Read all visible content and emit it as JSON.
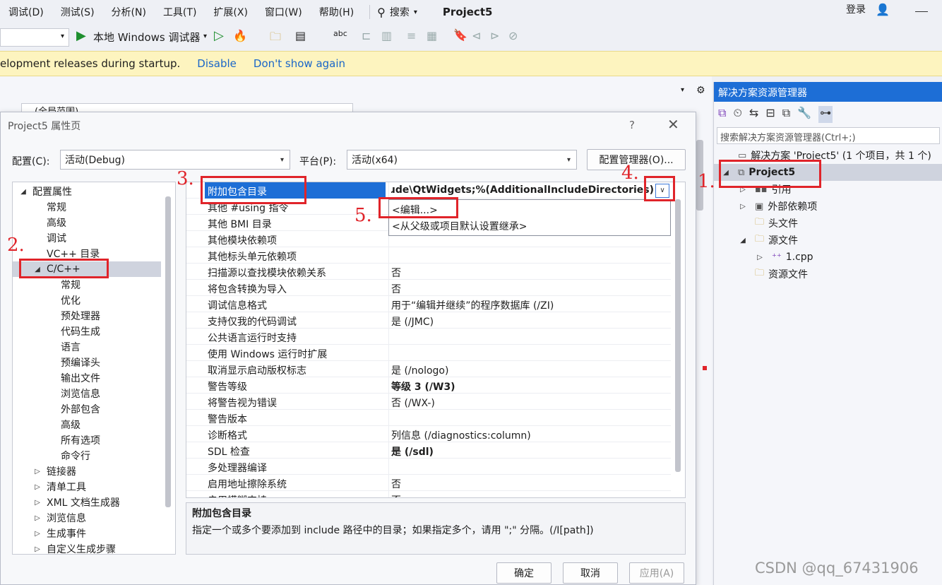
{
  "menu": [
    "调试(D)",
    "测试(S)",
    "分析(N)",
    "工具(T)",
    "扩展(X)",
    "窗口(W)",
    "帮助(H)"
  ],
  "search_label": "搜索",
  "project_title": "Project5",
  "login": "登录",
  "toolbar": {
    "debugger": "本地 Windows 调试器"
  },
  "infobar": {
    "message": "elopment releases during startup.",
    "disable": "Disable",
    "dont_show": "Don't show again"
  },
  "editor": {
    "scope": "(全局范围)"
  },
  "dialog": {
    "title": "Project5 属性页",
    "help": "?",
    "config_label": "配置(C):",
    "config_value": "活动(Debug)",
    "platform_label": "平台(P):",
    "platform_value": "活动(x64)",
    "config_manager": "配置管理器(O)...",
    "ok": "确定",
    "cancel": "取消",
    "apply": "应用(A)"
  },
  "tree": [
    {
      "label": "配置属性",
      "level": 0,
      "exp": "open"
    },
    {
      "label": "常规",
      "level": 1
    },
    {
      "label": "高级",
      "level": 1
    },
    {
      "label": "调试",
      "level": 1
    },
    {
      "label": "VC++ 目录",
      "level": 1
    },
    {
      "label": "C/C++",
      "level": 1,
      "exp": "open",
      "selected": true
    },
    {
      "label": "常规",
      "level": 2
    },
    {
      "label": "优化",
      "level": 2
    },
    {
      "label": "预处理器",
      "level": 2
    },
    {
      "label": "代码生成",
      "level": 2
    },
    {
      "label": "语言",
      "level": 2
    },
    {
      "label": "预编译头",
      "level": 2
    },
    {
      "label": "输出文件",
      "level": 2
    },
    {
      "label": "浏览信息",
      "level": 2
    },
    {
      "label": "外部包含",
      "level": 2
    },
    {
      "label": "高级",
      "level": 2
    },
    {
      "label": "所有选项",
      "level": 2
    },
    {
      "label": "命令行",
      "level": 2
    },
    {
      "label": "链接器",
      "level": 1,
      "exp": "closed"
    },
    {
      "label": "清单工具",
      "level": 1,
      "exp": "closed"
    },
    {
      "label": "XML 文档生成器",
      "level": 1,
      "exp": "closed"
    },
    {
      "label": "浏览信息",
      "level": 1,
      "exp": "closed"
    },
    {
      "label": "生成事件",
      "level": 1,
      "exp": "closed"
    },
    {
      "label": "自定义生成步骤",
      "level": 1,
      "exp": "closed"
    }
  ],
  "props": [
    {
      "name": "附加包含目录",
      "value": "nclude\\QtWidgets;%(AdditionalIncludeDirectories)",
      "selected": true,
      "bold": true
    },
    {
      "name": "其他 #using 指令",
      "value": ""
    },
    {
      "name": "其他 BMI 目录",
      "value": ""
    },
    {
      "name": "其他模块依赖项",
      "value": ""
    },
    {
      "name": "其他标头单元依赖项",
      "value": ""
    },
    {
      "name": "扫描源以查找模块依赖关系",
      "value": "否"
    },
    {
      "name": "将包含转换为导入",
      "value": "否"
    },
    {
      "name": "调试信息格式",
      "value": "用于“编辑并继续”的程序数据库 (/ZI)"
    },
    {
      "name": "支持仅我的代码调试",
      "value": "是 (/JMC)"
    },
    {
      "name": "公共语言运行时支持",
      "value": ""
    },
    {
      "name": "使用 Windows 运行时扩展",
      "value": ""
    },
    {
      "name": "取消显示启动版权标志",
      "value": "是 (/nologo)"
    },
    {
      "name": "警告等级",
      "value": "等级 3 (/W3)",
      "bold": true
    },
    {
      "name": "将警告视为错误",
      "value": "否 (/WX-)"
    },
    {
      "name": "警告版本",
      "value": ""
    },
    {
      "name": "诊断格式",
      "value": "列信息 (/diagnostics:column)"
    },
    {
      "name": "SDL 检查",
      "value": "是 (/sdl)",
      "bold": true
    },
    {
      "name": "多处理器编译",
      "value": ""
    },
    {
      "name": "启用地址擦除系统",
      "value": "否"
    },
    {
      "name": "启用模糊支持",
      "value": "否"
    }
  ],
  "dropdown": {
    "edit": "<编辑...>",
    "inherit": "<从父级或项目默认设置继承>"
  },
  "description": {
    "title": "附加包含目录",
    "text": "指定一个或多个要添加到 include 路径中的目录；如果指定多个，请用 \";\" 分隔。(/I[path])"
  },
  "solution": {
    "title": "解决方案资源管理器",
    "search_placeholder": "搜索解决方案资源管理器(Ctrl+;)",
    "items": [
      {
        "label": "解决方案 'Project5' (1 个项目，共 1 个)",
        "level": 0,
        "icon": "solution-icon"
      },
      {
        "label": "Project5",
        "level": 0,
        "exp": "open",
        "bold": true,
        "selected": true,
        "icon": "project-icon"
      },
      {
        "label": "引用",
        "level": 1,
        "exp": "closed",
        "icon": "references-icon"
      },
      {
        "label": "外部依赖项",
        "level": 1,
        "exp": "closed",
        "icon": "external-deps-icon"
      },
      {
        "label": "头文件",
        "level": 1,
        "icon": "folder-icon"
      },
      {
        "label": "源文件",
        "level": 1,
        "exp": "open",
        "icon": "folder-icon"
      },
      {
        "label": "1.cpp",
        "level": 2,
        "exp": "closed",
        "icon": "cpp-file-icon"
      },
      {
        "label": "资源文件",
        "level": 1,
        "icon": "folder-icon"
      }
    ]
  },
  "annotations": [
    "1.",
    "2.",
    "3.",
    "4.",
    "5."
  ],
  "watermark": "CSDN @qq_67431906",
  "colors": {
    "accent": "#1d6ed6",
    "selection": "#cfd3de",
    "annotation": "#e0242a",
    "infobar": "#fdf4bf"
  }
}
